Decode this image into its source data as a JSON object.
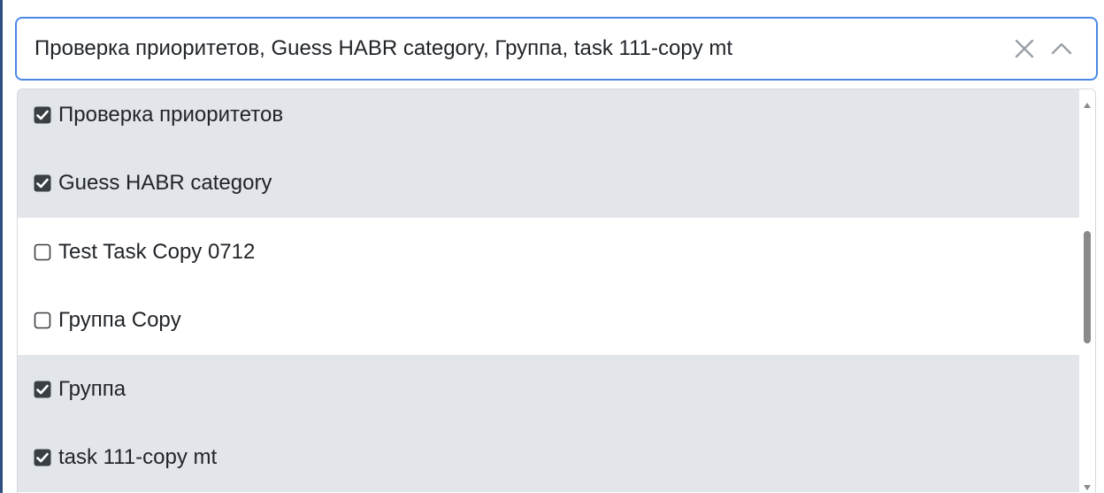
{
  "multiselect": {
    "value_text": "Проверка приоритетов, Guess HABR category, Группа, task 111-copy mt",
    "clear_icon": "close-icon",
    "toggle_icon": "chevron-up-icon",
    "accent_color": "#4a88e5"
  },
  "options": [
    {
      "label": "Проверка приоритетов",
      "checked": true
    },
    {
      "label": "Guess HABR category",
      "checked": true
    },
    {
      "label": "Test Task Copy 0712",
      "checked": false
    },
    {
      "label": "Группа Copy",
      "checked": false
    },
    {
      "label": "Группа",
      "checked": true
    },
    {
      "label": "task 111-copy mt",
      "checked": true
    }
  ],
  "scrollbar": {
    "up_icon": "scroll-up-arrow-icon",
    "down_icon": "scroll-down-arrow-icon"
  },
  "colors": {
    "selected_row": "#e2e5ea",
    "checkbox_checked": "#3a3f44",
    "text": "#212529"
  }
}
